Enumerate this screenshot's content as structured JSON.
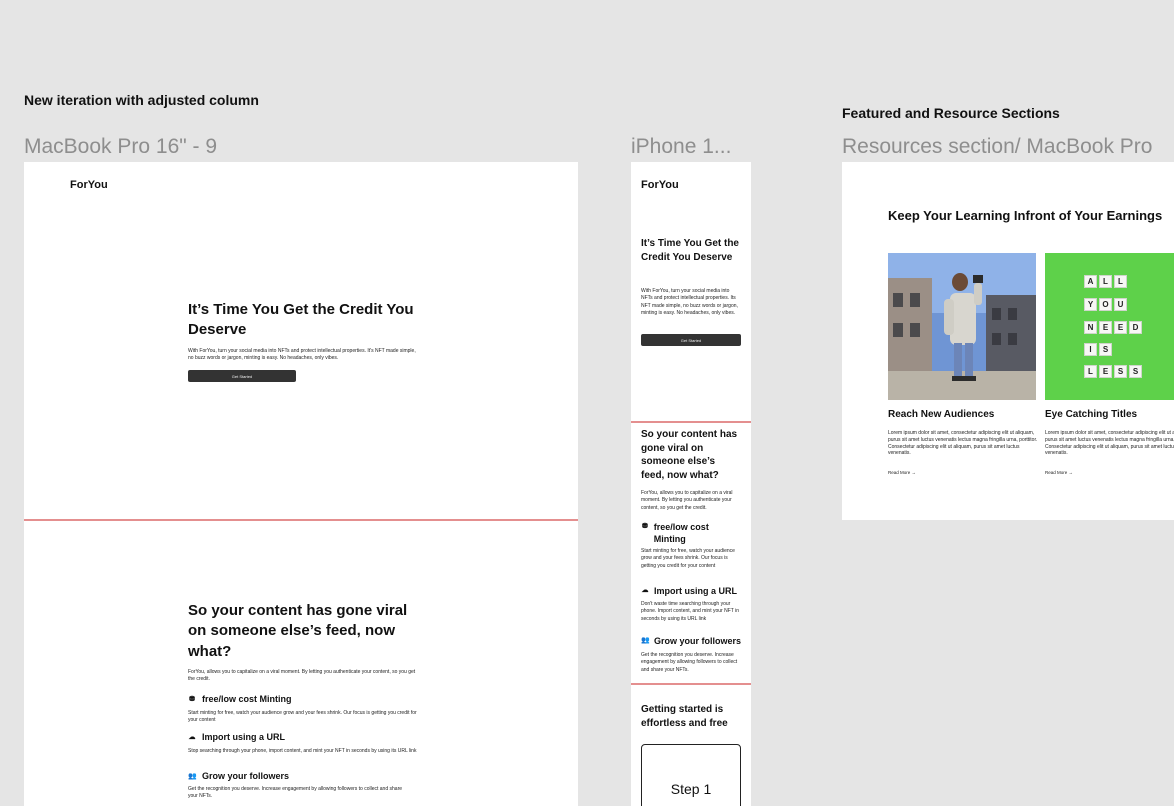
{
  "canvas": {
    "labels": {
      "iteration": "New iteration with adjusted column",
      "featured": "Featured and Resource Sections"
    },
    "frames": {
      "macbook": "MacBook Pro 16\" - 9",
      "iphone": "iPhone 1...",
      "resources": "Resources section/ MacBook Pro"
    }
  },
  "brand": {
    "logo": "ForYou"
  },
  "hero": {
    "title": "It’s Time You Get the Credit You Deserve",
    "body": "With ForYou, turn your social media into NFTs and protect intellectual properties. It's NFT made simple, no buzz words or jargon, minting is easy. No headaches, only vibes.",
    "body_mobile": "With ForYou, turn your social media into NFTs and protect intellectual properties. Its NFT made simple, no buzz words or jargon, minting is easy. No headaches, only vibes.",
    "cta": "Get Started"
  },
  "viral": {
    "title": "So your content has gone viral on someone else’s feed, now what?",
    "body": "ForYou, allows you to capitalize on a viral moment. By letting you authenticate your content, so you get the credit.",
    "features": [
      {
        "icon": "coins-icon",
        "glyph": "⛃",
        "title": "free/low cost Minting",
        "body": "Start minting for free, watch your audience grow and your fees shrink. Our focus is getting you credit for your content"
      },
      {
        "icon": "cloud-upload-icon",
        "glyph": "☁",
        "title": "Import using a URL",
        "body": "Stop searching through your phone, import content, and mint your NFT in seconds by using its URL link"
      },
      {
        "icon": "people-icon",
        "glyph": "👥",
        "title": "Grow your followers",
        "body": "Get the recognition you deserve. Increase engagement by allowing followers to collect and share your NFTs."
      }
    ],
    "features_mobile": [
      {
        "title": "free/low cost Minting",
        "body": "Start minting for free, watch your audience grow and your fees shrink. Our focus is getting you credit for your content"
      },
      {
        "title": "Import using a URL",
        "body": "Don't waste time searching through your phone. Import content, and mint your NFT in seconds by using its URL link"
      },
      {
        "title": "Grow your followers",
        "body": "Get the recognition you deserve. Increase engagement by allowing followers to collect and share your NFTs."
      }
    ]
  },
  "getting_started": {
    "title": "Getting started is effortless and free",
    "step1": "Step 1"
  },
  "resources": {
    "heading": "Keep Your Learning Infront of Your Earnings",
    "cards": [
      {
        "title": "Reach New Audiences",
        "body": "Lorem ipsum dolor sit amet, consectetur adipiscing elit ut aliquam, purus sit amet luctus venenatis lectus magna fringilla urna, porttitor. Consectetur adipiscing elit ut aliquam, purus sit amet luctus venenatis.",
        "read_more": "Read More →"
      },
      {
        "title": "Eye Catching Titles",
        "body": "Lorem ipsum dolor sit amet, consectetur adipiscing elit ut aliquam, purus sit amet luctus venenatis lectus magna fringilla urna, porttitor. Consectetur adipiscing elit ut aliquam, purus sit amet luctus venenatis.",
        "read_more": "Read More →"
      }
    ],
    "tiles": [
      [
        "A",
        "L",
        "L"
      ],
      [
        "Y",
        "O",
        "U"
      ],
      [
        "N",
        "E",
        "E",
        "D"
      ],
      [
        "I",
        "S"
      ],
      [
        "L",
        "E",
        "S",
        "S"
      ]
    ]
  },
  "colors": {
    "canvas": "#e5e5e5",
    "divider": "#e48f8f",
    "button": "#333333",
    "green": "#5ed14a"
  }
}
